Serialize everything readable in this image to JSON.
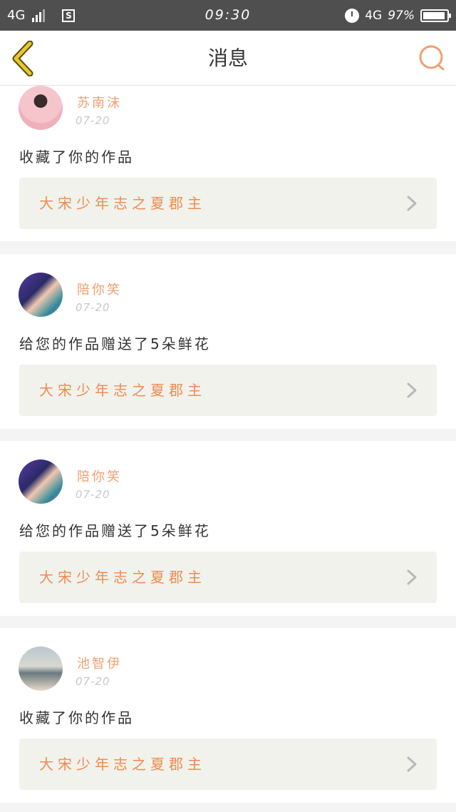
{
  "status_bar": {
    "network_left": "4G",
    "time": "09:30",
    "network_right": "4G",
    "battery": "97%"
  },
  "header": {
    "title": "消息"
  },
  "messages": [
    {
      "username": "苏南沫",
      "date": "07-20",
      "action": "收藏了你的作品",
      "work_title": "大宋少年志之夏郡主"
    },
    {
      "username": "陪你笑",
      "date": "07-20",
      "action": "给您的作品赠送了5朵鲜花",
      "work_title": "大宋少年志之夏郡主"
    },
    {
      "username": "陪你笑",
      "date": "07-20",
      "action": "给您的作品赠送了5朵鲜花",
      "work_title": "大宋少年志之夏郡主"
    },
    {
      "username": "池智伊",
      "date": "07-20",
      "action": "收藏了你的作品",
      "work_title": "大宋少年志之夏郡主"
    }
  ],
  "colors": {
    "accent": "#f08a50",
    "back_icon": "#e8c72a",
    "search_icon": "#f0a070"
  }
}
